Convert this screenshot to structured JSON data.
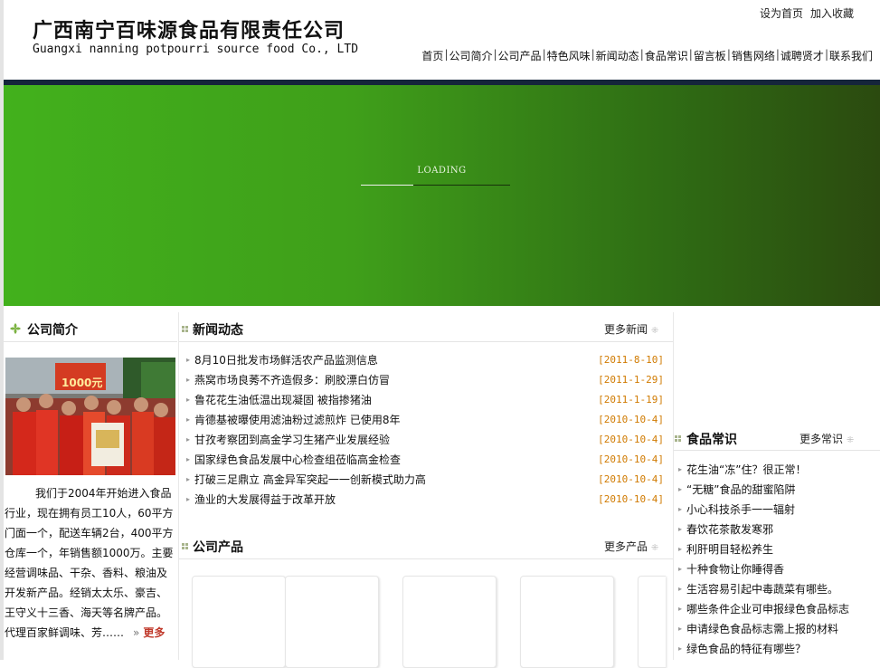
{
  "header": {
    "company_cn": "广西南宁百味源食品有限责任公司",
    "company_en": "Guangxi nanning potpourri source food Co., LTD",
    "top_links": [
      "设为首页",
      "加入收藏"
    ],
    "nav": [
      "首页",
      "公司简介",
      "公司产品",
      "特色风味",
      "新闻动态",
      "食品常识",
      "留言板",
      "销售网络",
      "诚聘贤才",
      "联系我们"
    ],
    "nav_separator": "|"
  },
  "banner": {
    "loading_text": "LOADING",
    "progress": 0.35
  },
  "about": {
    "title": "公司简介",
    "photo_sign": "1000元",
    "text": "我们于2004年开始进入食品行业，现在拥有员工10人，60平方门面一个，配送车辆2台，400平方仓库一个，年销售额1000万。主要经营调味品、干杂、香料、粮油及开发新产品。经销太太乐、豪吉、王守义十三香、海天等名牌产品。代理百家鲜调味、芳……",
    "more_label": "更多",
    "more_chevron": "»"
  },
  "news": {
    "title": "新闻动态",
    "more_label": "更多新闻",
    "items": [
      {
        "title": "8月10日批发市场鲜活农产品监测信息",
        "date": "[2011-8-10]"
      },
      {
        "title": "燕窝市场良莠不齐造假多：刷胶漂白仿冒",
        "date": "[2011-1-29]"
      },
      {
        "title": "鲁花花生油低温出现凝固 被指掺猪油",
        "date": "[2011-1-19]"
      },
      {
        "title": "肯德基被曝使用滤油粉过滤煎炸 已使用8年",
        "date": "[2010-10-4]"
      },
      {
        "title": "甘孜考察团到高金学习生猪产业发展经验",
        "date": "[2010-10-4]"
      },
      {
        "title": "国家绿色食品发展中心检查组莅临高金检查",
        "date": "[2010-10-4]"
      },
      {
        "title": "打破三足鼎立 高金异军突起一一创新模式助力高",
        "date": "[2010-10-4]"
      },
      {
        "title": "渔业的大发展得益于改革开放",
        "date": "[2010-10-4]"
      }
    ]
  },
  "products": {
    "title": "公司产品",
    "more_label": "更多产品"
  },
  "knowledge": {
    "title": "食品常识",
    "more_label": "更多常识",
    "items": [
      "花生油“冻”住？很正常！",
      "“无糖”食品的甜蜜陷阱",
      "小心科技杀手一一辐射",
      "春饮花茶散发寒邪",
      "利肝明目轻松养生",
      "十种食物让你睡得香",
      "生活容易引起中毒蔬菜有哪些。",
      "哪些条件企业可申报绿色食品标志",
      "申请绿色食品标志需上报的材料",
      "绿色食品的特征有哪些？"
    ]
  },
  "colors": {
    "nav_bar": "#15253b",
    "banner_green": "#42b11c",
    "date_orange": "#d07a00",
    "more_red": "#c0392b"
  },
  "icons": {
    "about": "leaf-icon",
    "section": "square-grid-icon",
    "more": "dotted-square-icon",
    "list_bullet": "triangle-bullet-icon"
  }
}
